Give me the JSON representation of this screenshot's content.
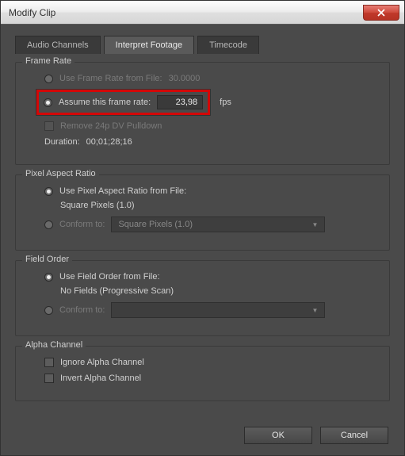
{
  "window": {
    "title": "Modify Clip"
  },
  "tabs": {
    "audio": "Audio Channels",
    "interpret": "Interpret Footage",
    "timecode": "Timecode"
  },
  "frameRate": {
    "title": "Frame Rate",
    "useFromFile": "Use Frame Rate from File:",
    "fromFileValue": "30.0000",
    "assume": "Assume this frame rate:",
    "assumeValue": "23,98",
    "fps": "fps",
    "removePulldown": "Remove 24p DV Pulldown",
    "durationLabel": "Duration:",
    "durationValue": "00;01;28;16"
  },
  "par": {
    "title": "Pixel Aspect Ratio",
    "useFromFile": "Use Pixel Aspect Ratio from File:",
    "fromFileValue": "Square Pixels (1.0)",
    "conform": "Conform to:",
    "conformValue": "Square Pixels (1.0)"
  },
  "fieldOrder": {
    "title": "Field Order",
    "useFromFile": "Use Field Order from File:",
    "fromFileValue": "No Fields (Progressive Scan)",
    "conform": "Conform to:"
  },
  "alpha": {
    "title": "Alpha Channel",
    "ignore": "Ignore Alpha Channel",
    "invert": "Invert Alpha Channel"
  },
  "buttons": {
    "ok": "OK",
    "cancel": "Cancel"
  }
}
